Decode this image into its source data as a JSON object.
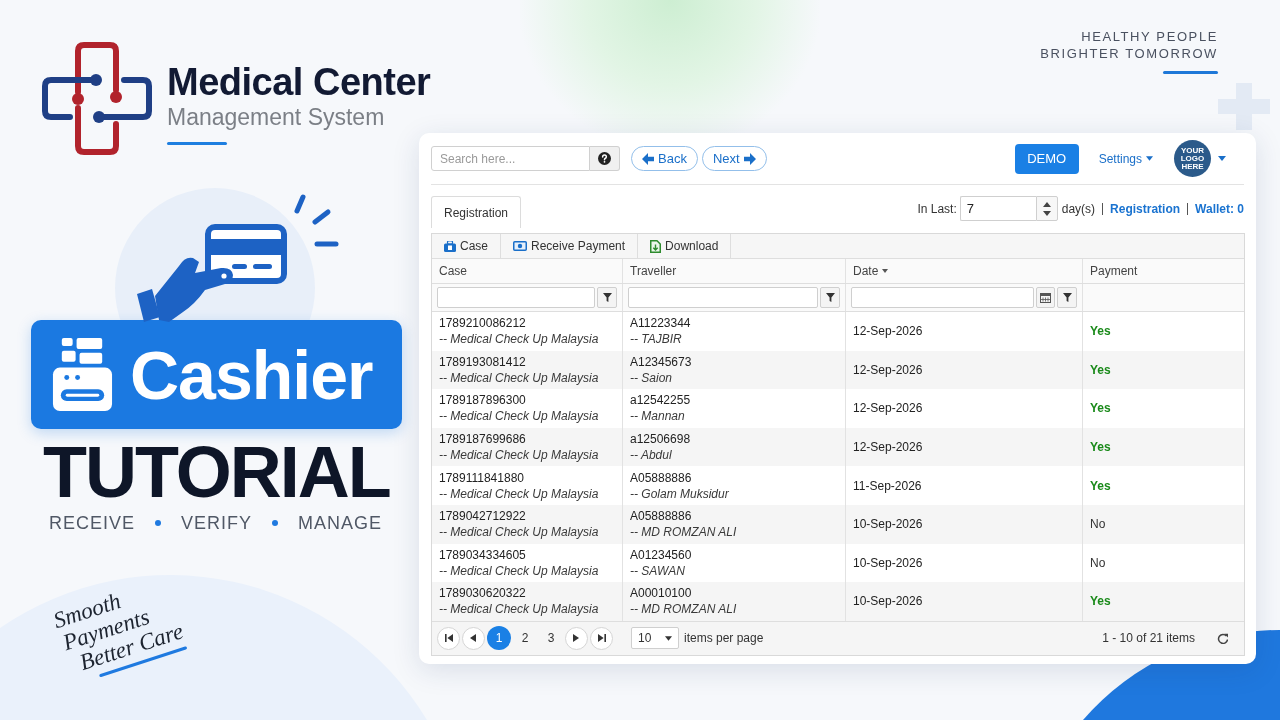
{
  "brand": {
    "title": "Medical Center",
    "subtitle": "Management System"
  },
  "tagline": [
    "HEALTHY PEOPLE",
    "BRIGHTER TOMORROW"
  ],
  "hero": {
    "badge": "Cashier",
    "heading": "TUTORIAL",
    "keywords": [
      "RECEIVE",
      "VERIFY",
      "MANAGE"
    ],
    "slogan": [
      "Smooth",
      "Payments",
      "Better Care"
    ]
  },
  "app": {
    "search": {
      "placeholder": "Search here..."
    },
    "nav_buttons": [
      {
        "label": "Back",
        "kind": "back"
      },
      {
        "label": "Next",
        "kind": "next"
      }
    ],
    "demo_button": "DEMO",
    "settings_menu": "Settings",
    "account_logo": [
      "YOUR",
      "LOGO",
      "HERE"
    ],
    "tabs": [
      {
        "label": "Registration",
        "selected": true
      }
    ],
    "period": {
      "label": "In Last:",
      "value": "7",
      "unit": "day(s)"
    },
    "links": [
      "Registration",
      "Wallet: 0"
    ],
    "actions": [
      {
        "label": "Case",
        "kind": "case"
      },
      {
        "label": "Receive Payment",
        "kind": "payment"
      },
      {
        "label": "Download",
        "kind": "download"
      }
    ],
    "columns": [
      {
        "label": "Case",
        "kind": "text",
        "sorted": false
      },
      {
        "label": "Traveller",
        "kind": "text",
        "sorted": false
      },
      {
        "label": "Date",
        "kind": "date",
        "sorted": true
      },
      {
        "label": "Payment",
        "kind": "none",
        "sorted": false
      }
    ],
    "rows": [
      {
        "case_no": "1789210086212",
        "package": "-- Medical Check Up Malaysia",
        "traveller_id": "A11223344",
        "traveller_name": "-- TAJBIR",
        "date": "12-Sep-2026",
        "payment": "Yes",
        "paid": true
      },
      {
        "case_no": "1789193081412",
        "package": "-- Medical Check Up Malaysia",
        "traveller_id": "A12345673",
        "traveller_name": "-- Saion",
        "date": "12-Sep-2026",
        "payment": "Yes",
        "paid": true
      },
      {
        "case_no": "1789187896300",
        "package": "-- Medical Check Up Malaysia",
        "traveller_id": "a12542255",
        "traveller_name": "-- Mannan",
        "date": "12-Sep-2026",
        "payment": "Yes",
        "paid": true
      },
      {
        "case_no": "1789187699686",
        "package": "-- Medical Check Up Malaysia",
        "traveller_id": "a12506698",
        "traveller_name": "-- Abdul",
        "date": "12-Sep-2026",
        "payment": "Yes",
        "paid": true
      },
      {
        "case_no": "1789111841880",
        "package": "-- Medical Check Up Malaysia",
        "traveller_id": "A05888886",
        "traveller_name": "-- Golam Muksidur",
        "date": "11-Sep-2026",
        "payment": "Yes",
        "paid": true
      },
      {
        "case_no": "1789042712922",
        "package": "-- Medical Check Up Malaysia",
        "traveller_id": "A05888886",
        "traveller_name": "-- MD ROMZAN ALI",
        "date": "10-Sep-2026",
        "payment": "No",
        "paid": false
      },
      {
        "case_no": "1789034334605",
        "package": "-- Medical Check Up Malaysia",
        "traveller_id": "A01234560",
        "traveller_name": "-- SAWAN",
        "date": "10-Sep-2026",
        "payment": "No",
        "paid": false
      },
      {
        "case_no": "1789030620322",
        "package": "-- Medical Check Up Malaysia",
        "traveller_id": "A00010100",
        "traveller_name": "-- MD ROMZAN ALI",
        "date": "10-Sep-2026",
        "payment": "Yes",
        "paid": true
      }
    ],
    "pager": {
      "pages": [
        {
          "label": "1",
          "selected": true
        },
        {
          "label": "2",
          "selected": false
        },
        {
          "label": "3",
          "selected": false
        }
      ],
      "page_size": "10",
      "page_size_label": "items per page",
      "summary": "1 - 10 of 21 items"
    }
  }
}
